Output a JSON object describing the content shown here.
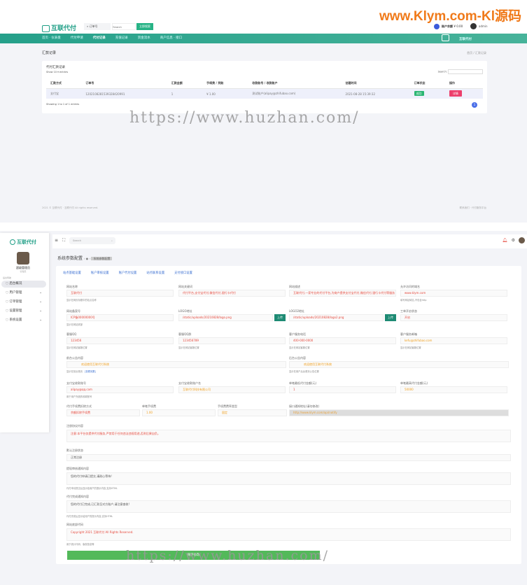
{
  "watermarks": {
    "top": "www.Klym.com-Kl源码",
    "mid": "https://www.huzhan.com/"
  },
  "screen1": {
    "brand": "互联代付",
    "search": {
      "select": "订单号",
      "placeholder": "Search",
      "button": "立即搜索"
    },
    "user": {
      "balance_label": "账户余额",
      "balance": "¥ 0.00",
      "name": "admin"
    },
    "nav": [
      "首页 · 仪表盘",
      "代付申请",
      "代付记录",
      "充值记录",
      "资金流水",
      "商户信息 · 接口"
    ],
    "page_title": "汇款记录",
    "breadcrumb": "首页 / 汇款记录",
    "card_title": "代付汇款记录",
    "show": "Show",
    "entries_count": "10",
    "entries": "entries",
    "search_label": "Search:",
    "columns": [
      "汇款方式",
      "订单号",
      "汇款金额",
      "手续费 / 到账",
      "收款账号 / 收款账户",
      "创建时间",
      "订单状态",
      "操作"
    ],
    "rows": [
      [
        "支付宝",
        "1202108281539328420991",
        "1",
        "¥ 1.00",
        "测试账户(alipay@zhifubao.com)",
        "2021-08-28 15:39:32",
        "成功",
        "详情"
      ]
    ],
    "showing": "Showing 1 to 1 of 1 entries",
    "page": "1",
    "footer_left": "2021 © 互联代付 · 互联代付 All rights reserved.",
    "footer_right": "联系我们 · 代付服务平台"
  },
  "screen2": {
    "brand": "互联代付",
    "admin_name": "超级管理员",
    "admin_role": "管理员",
    "menu_heading": "后台导航",
    "menu": [
      "后台概况",
      "用户管理",
      "订单管理",
      "设置管理",
      "系统设置"
    ],
    "search_placeholder": "Search",
    "page_title": "系统参数配置",
    "breadcrumb": "系统参数配置",
    "tabs": [
      "站点基础设置",
      "账户审核设置",
      "账户代付设置",
      "站点联系设置",
      "支付接口设置"
    ],
    "fields": [
      {
        "label": "网站名称",
        "value": "互联代付",
        "help": "显示在网页标题中的站点名称"
      },
      {
        "label": "网站关键词",
        "value": "代付平台,支付宝代付,微信代付,银行卡代付"
      },
      {
        "label": "网站描述",
        "value": "互联代付,一家专业的代付平台,为商户提供支付宝代付,微信代付,银行卡代付等服务"
      },
      {
        "label": "允许访问的域名",
        "value": "www.klym.com",
        "help": "填写网站域名,不包含http"
      },
      {
        "label": "网站备案号",
        "value": "ICP备00000000号",
        "help": "显示在网站底部"
      },
      {
        "label": "LOGO地址",
        "value": "/static/uploads/20210828/logo.png",
        "button": "上传"
      },
      {
        "label": "LOGO2地址",
        "value": "/static/uploads/20210828/logo2.png",
        "button": "上传"
      },
      {
        "label": "工单开启状态",
        "value": "开启"
      },
      {
        "label": "客服QQ",
        "value": "123456",
        "help": "显示在网站客服位置"
      },
      {
        "label": "客服QQ群",
        "value": "123456789",
        "help": "显示在网站客服位置"
      },
      {
        "label": "客户服务电话",
        "value": "400-000-0000",
        "help": "显示在网站客服位置"
      },
      {
        "label": "客户服务邮箱",
        "value": "kefu@zhifubao.com",
        "help": "显示在网站客服位置"
      },
      {
        "label": "前台公告内容",
        "value": "欢迎使用互联代付系统",
        "help": "显示在前台首页",
        "link": "[查看效果]"
      },
      {
        "label": "后台公告内容",
        "value": "欢迎使用互联代付系统",
        "help": "显示在用户后台首页公告位置"
      },
      {
        "label": "支付宝收款账号",
        "value": "alipay@qq.com",
        "help": "用于用户充值的收款账号"
      },
      {
        "label": "支付宝收款账户名",
        "value": "互联代付科技有限公司"
      },
      {
        "label": "单笔最低代付金额(元)",
        "value": "1"
      },
      {
        "label": "单笔最高代付金额(元)",
        "value": "50000"
      },
      {
        "label": "代付手续费扣除方式",
        "value": "余额扣除手续费"
      },
      {
        "label": "单笔手续费",
        "value": "1.00"
      },
      {
        "label": "手续费费率类型",
        "value": "固定"
      },
      {
        "label": "接口通知地址(请勿修改)",
        "value": "http://www.klym.com/api/notify"
      }
    ],
    "textareas": [
      {
        "label": "注册协议内容",
        "value": "注意:本平台仅提供代付服务,严禁用于任何违法违规用途,否则后果自负。"
      },
      {
        "label": "默认注册状态",
        "value": "正常注册",
        "select": true
      },
      {
        "label": "提现审核通知内容",
        "value": "您的代付申请已提交,请耐心等待!",
        "help": "代付申请提交后显示给用户的提示内容,支持HTML"
      },
      {
        "label": "代付完成通知内容",
        "value": "您的代付已完成,已汇款至对方账户,请注意查收!",
        "help": "代付完成后显示给用户的提示内容,支持HTML"
      },
      {
        "label": "网站底部代码",
        "value": "Copyright 2021 互联代付 All Rights Reserved.",
        "help": "用于统计代码、版权信息等"
      }
    ],
    "save_button": "保存修改"
  }
}
